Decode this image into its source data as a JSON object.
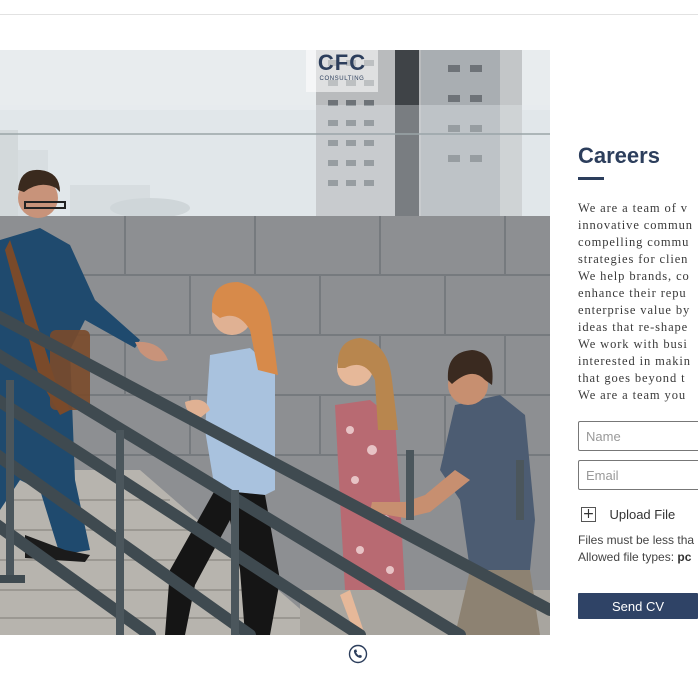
{
  "brand": {
    "logo_text": "CFC",
    "logo_subtext": "CONSULTING"
  },
  "careers": {
    "title": "Careers",
    "intro_lines": [
      "We are a team of v",
      "innovative commun",
      "compelling commu",
      "strategies for clien",
      "We help brands, co",
      "enhance their repu",
      "enterprise value by",
      "ideas that re-shape",
      "We work with busi",
      "interested in makin",
      "that goes beyond t",
      "We are a team you"
    ],
    "form": {
      "name_placeholder": "Name",
      "email_placeholder": "Email",
      "upload_label": "Upload File",
      "file_size_note": "Files must be less tha",
      "file_types_label": "Allowed file types: ",
      "file_types_value": "pc",
      "submit_label": "Send CV"
    }
  },
  "icons": {
    "upload": "plus-icon",
    "footer": "phone-icon"
  },
  "colors": {
    "brand_navy": "#2c3e5c",
    "button_bg": "#2f4366"
  }
}
